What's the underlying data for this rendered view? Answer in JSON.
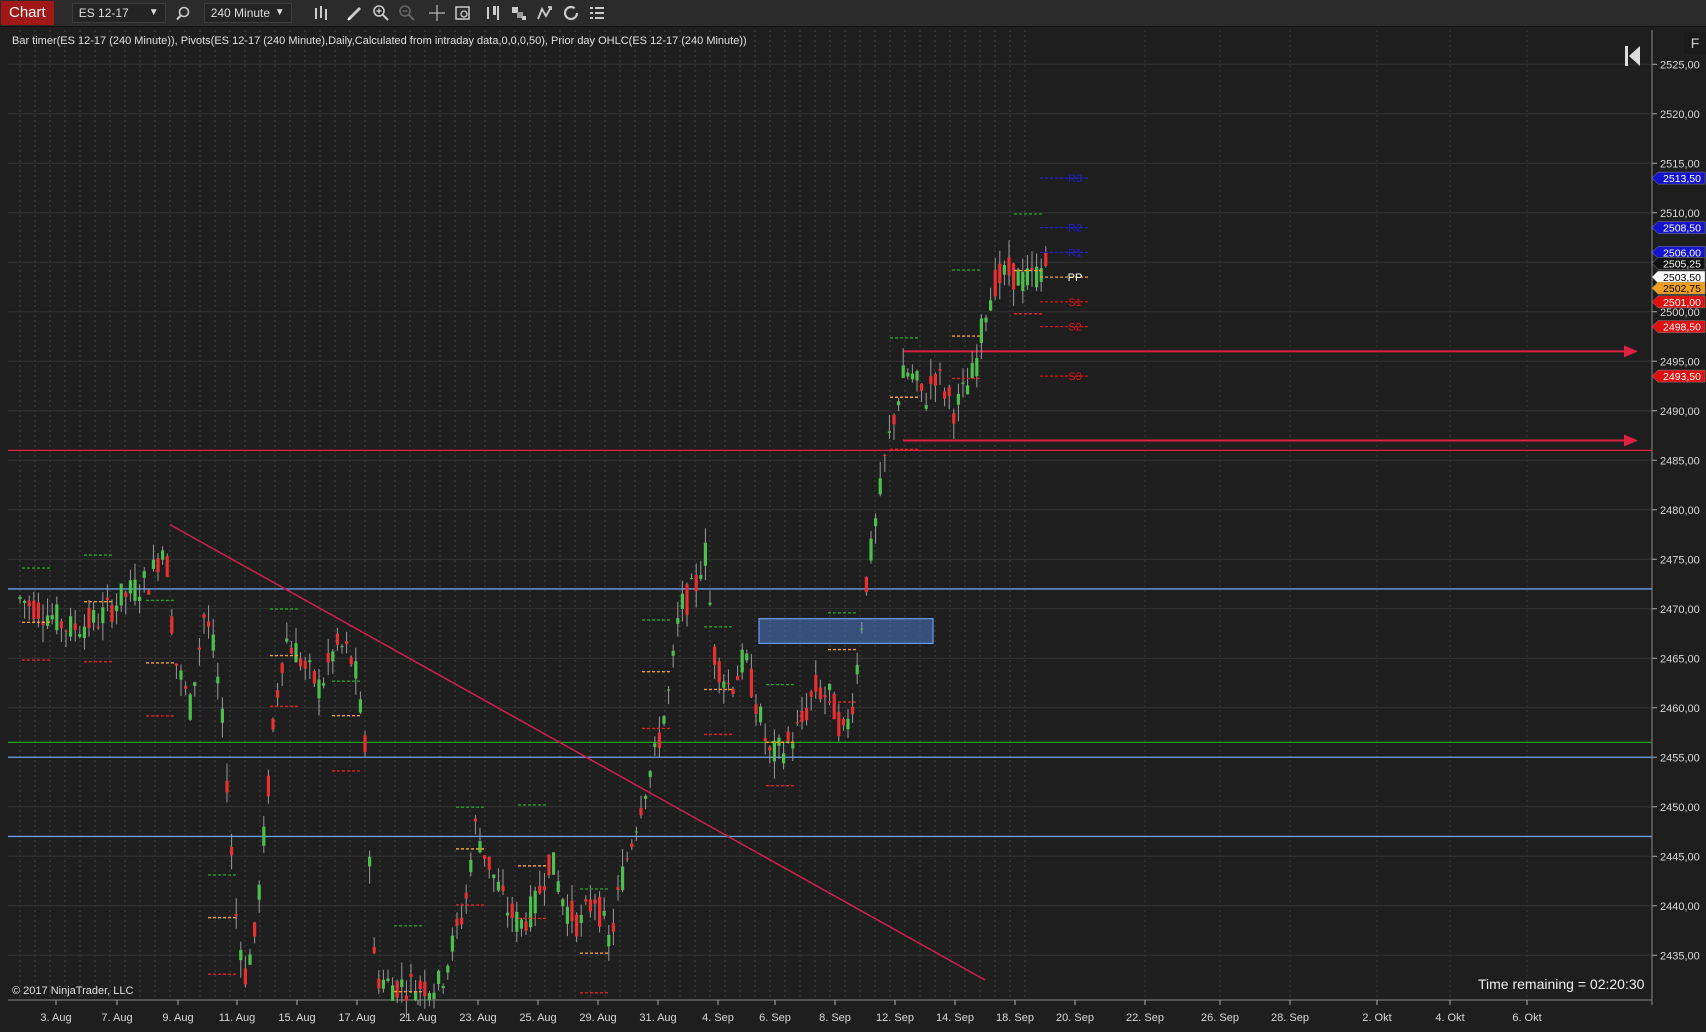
{
  "toolbar": {
    "tab_label": "Chart",
    "instrument": "ES 12-17",
    "interval": "240 Minute",
    "icons": [
      "search-icon",
      "bar-type-icon",
      "drawing-pencil-icon",
      "zoom-in-icon",
      "zoom-out-icon",
      "crosshair-icon",
      "data-box-icon",
      "chart-style-icon",
      "indicators-icon",
      "strategies-icon",
      "reload-icon",
      "properties-icon"
    ]
  },
  "side_button": "F",
  "chart": {
    "indicator_summary": "Bar timer(ES 12-17 (240 Minute)), Pivots(ES 12-17 (240 Minute),Daily,Calculated from intraday data,0,0,0,50), Prior day OHLC(ES 12-17 (240 Minute))",
    "copyright": "© 2017 NinjaTrader, LLC",
    "time_remaining": "Time remaining = 02:20:30",
    "x_labels": [
      "3. Aug",
      "7. Aug",
      "9. Aug",
      "11. Aug",
      "15. Aug",
      "17. Aug",
      "21. Aug",
      "23. Aug",
      "25. Aug",
      "29. Aug",
      "31. Aug",
      "4. Sep",
      "6. Sep",
      "8. Sep",
      "12. Sep",
      "14. Sep",
      "18. Sep",
      "20. Sep",
      "22. Sep",
      "26. Sep",
      "28. Sep",
      "2. Okt",
      "4. Okt",
      "6. Okt"
    ],
    "y_ticks": [
      "2525,00",
      "2520,00",
      "2515,00",
      "2510,00",
      "2505,00",
      "2500,00",
      "2495,00",
      "2490,00",
      "2485,00",
      "2480,00",
      "2475,00",
      "2470,00",
      "2465,00",
      "2460,00",
      "2455,00",
      "2450,00",
      "2445,00",
      "2440,00",
      "2435,00"
    ],
    "price_markers": [
      {
        "label": "2513,50",
        "value": 2513.5,
        "color": "#1414cc",
        "text_color": "#ffffff"
      },
      {
        "label": "2508,50",
        "value": 2508.5,
        "color": "#1414cc",
        "text_color": "#ffffff"
      },
      {
        "label": "2506,00",
        "value": 2506.0,
        "color": "#1414cc",
        "text_color": "#ffffff"
      },
      {
        "label": "2505,25",
        "value": 2505.25,
        "color": "#111111",
        "text_color": "#ffffff"
      },
      {
        "label": "2503,50",
        "value": 2503.5,
        "color": "#ffffff",
        "text_color": "#000000"
      },
      {
        "label": "2502,75",
        "value": 2502.75,
        "color": "#f0a020",
        "text_color": "#000000"
      },
      {
        "label": "2501,00",
        "value": 2501.0,
        "color": "#e01010",
        "text_color": "#ffffff"
      },
      {
        "label": "2498,50",
        "value": 2498.5,
        "color": "#e01010",
        "text_color": "#ffffff"
      },
      {
        "label": "2493,50",
        "value": 2493.5,
        "color": "#e01010",
        "text_color": "#ffffff"
      }
    ],
    "pivot_labels": [
      {
        "label": "R3",
        "value": 2513.5,
        "color": "#2020cc"
      },
      {
        "label": "R2",
        "value": 2508.5,
        "color": "#2020cc"
      },
      {
        "label": "R1",
        "value": 2506.0,
        "color": "#2020cc"
      },
      {
        "label": "PP",
        "value": 2503.5,
        "color": "#ffffff"
      },
      {
        "label": "S1",
        "value": 2501.0,
        "color": "#dd1010"
      },
      {
        "label": "S2",
        "value": 2498.5,
        "color": "#dd1010"
      },
      {
        "label": "S3",
        "value": 2493.5,
        "color": "#dd1010"
      }
    ],
    "horizontal_lines": [
      {
        "value": 2486.0,
        "color": "#e02040"
      },
      {
        "value": 2472.0,
        "color": "#6a9ee8"
      },
      {
        "value": 2456.5,
        "color": "#20a020"
      },
      {
        "value": 2455.0,
        "color": "#6a9ee8"
      },
      {
        "value": 2447.0,
        "color": "#6a9ee8"
      }
    ],
    "ray_lines": [
      {
        "value": 2496.0,
        "color": "#e02040"
      },
      {
        "value": 2487.0,
        "color": "#e02040"
      }
    ],
    "trend_line": {
      "from_value": 2478.5,
      "to_value": 2432.5,
      "color": "#d02050"
    },
    "zone": {
      "low": 2466.5,
      "high": 2469.0,
      "color": "#4a78c8"
    },
    "colors": {
      "up": "#4cc04c",
      "down": "#e83030",
      "background": "#1e1e1e",
      "grid": "#444444",
      "accent": "#a01818"
    }
  }
}
